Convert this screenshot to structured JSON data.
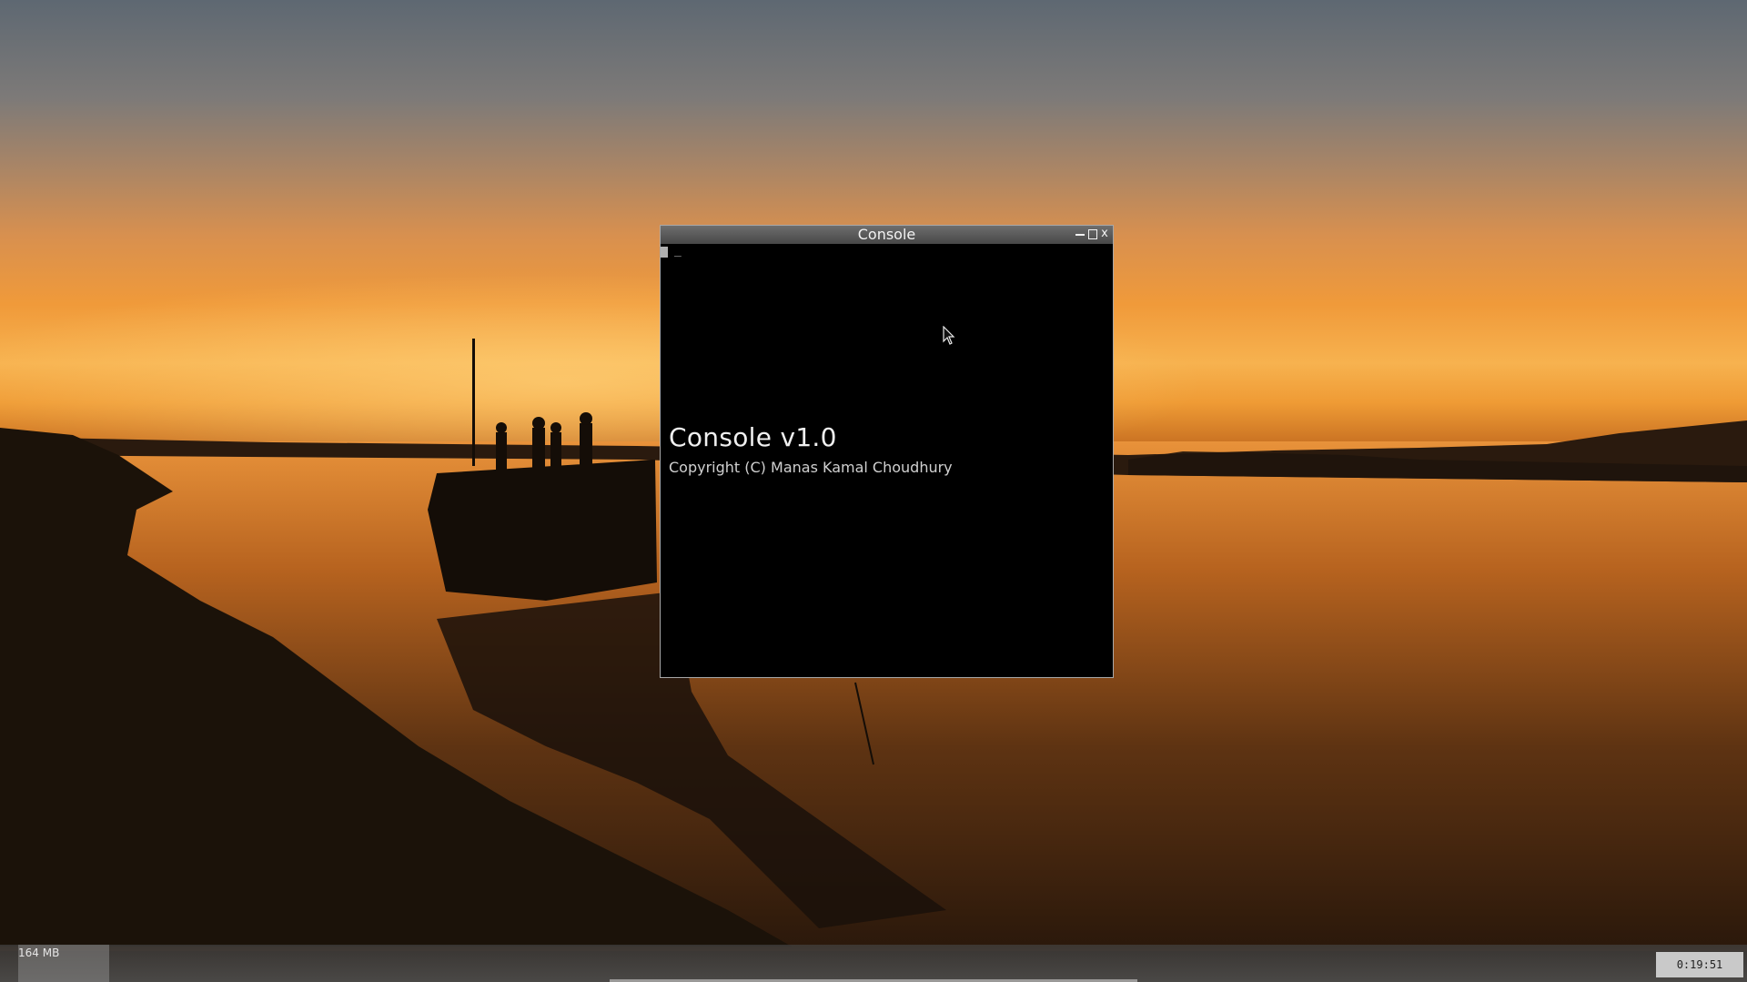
{
  "window": {
    "title": "Console",
    "controls": {
      "minimize_icon": "minimize-icon",
      "maximize_icon": "maximize-icon",
      "close_label": "x"
    }
  },
  "console": {
    "cursor_text": "_",
    "banner_title": "Console v1.0",
    "banner_copyright": "Copyright (C) Manas Kamal Choudhury",
    "background_color": "#000000",
    "text_color": "#f0f0f0"
  },
  "taskbar": {
    "memory_text": "164   MB",
    "clock_text": "0:19:51"
  },
  "desktop": {
    "wallpaper": "sunset-river-with-boat-silhouette"
  }
}
